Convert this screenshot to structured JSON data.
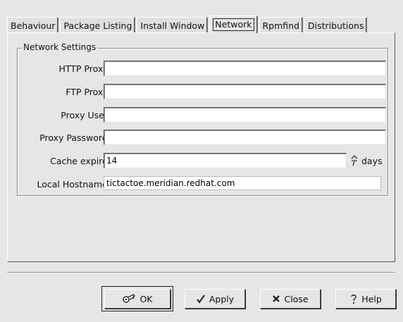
{
  "tabs": [
    {
      "label": "Behaviour",
      "active": false
    },
    {
      "label": "Package Listing",
      "active": false
    },
    {
      "label": "Install Window",
      "active": false
    },
    {
      "label": "Network",
      "active": true
    },
    {
      "label": "Rpmfind",
      "active": false
    },
    {
      "label": "Distributions",
      "active": false
    }
  ],
  "network_settings": {
    "title": "Network Settings",
    "http_proxy": {
      "label": "HTTP Proxy:",
      "value": ""
    },
    "ftp_proxy": {
      "label": "FTP Proxy:",
      "value": ""
    },
    "proxy_user": {
      "label": "Proxy User:",
      "value": ""
    },
    "proxy_password": {
      "label": "Proxy Password:",
      "value": ""
    },
    "cache_expire": {
      "label": "Cache expire:",
      "value": "14",
      "unit": "days"
    },
    "local_hostname": {
      "label": "Local Hostname:",
      "value": "tictactoe.meridian.redhat.com"
    }
  },
  "buttons": {
    "ok": {
      "label": "OK",
      "icon": "key-icon"
    },
    "apply": {
      "label": "Apply",
      "icon": "checkmark-icon"
    },
    "close": {
      "label": "Close",
      "icon": "x-icon"
    },
    "help": {
      "label": "Help",
      "icon": "question-icon"
    }
  }
}
